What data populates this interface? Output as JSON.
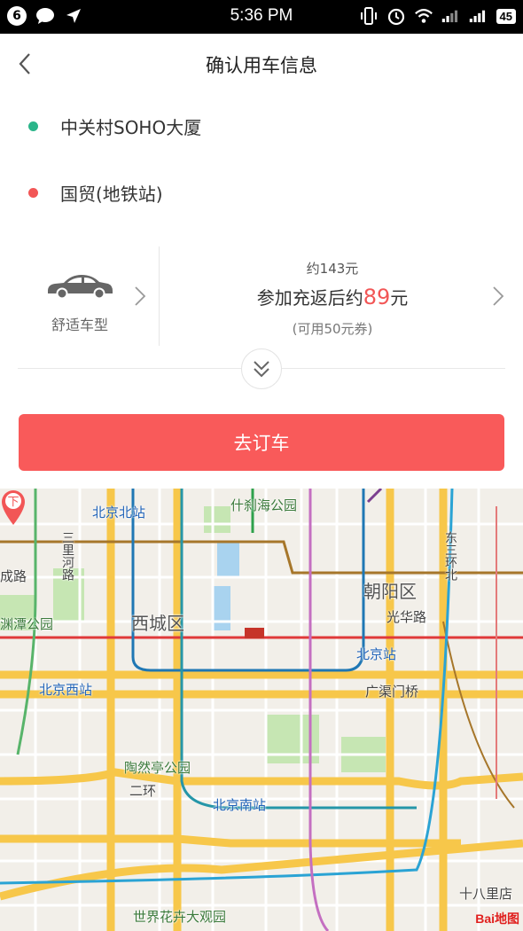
{
  "status_bar": {
    "notification_count": "6",
    "time": "5:36 PM",
    "battery": "45"
  },
  "header": {
    "title": "确认用车信息"
  },
  "route": {
    "start": "中关村SOHO大厦",
    "end": "国贸(地铁站)",
    "start_color": "#2bb58a",
    "end_color": "#f25656"
  },
  "car": {
    "type_label": "舒适车型"
  },
  "price": {
    "approx": "约143元",
    "main_prefix": "参加充返后约",
    "main_value": "89",
    "main_suffix": "元",
    "coupon": "(可用50元券)"
  },
  "order_button": {
    "label": "去订车",
    "color": "#f95a5a"
  },
  "map": {
    "labels": {
      "beijing_north": "北京北站",
      "shichahai": "什刹海公园",
      "sanlihe": "三里河路",
      "chengqu": "成路",
      "yuyuantan": "渊潭公园",
      "xicheng": "西城区",
      "chaoyang": "朝阳区",
      "guanghua": "光华路",
      "dongsanhuan": "东三环北",
      "beijing_station": "北京站",
      "beijing_west": "北京西站",
      "guangqumen": "广渠门桥",
      "taoranting": "陶然亭公园",
      "erhuan": "二环",
      "beijing_south": "北京南站",
      "shibali": "十八里店",
      "shijie_huahui": "世界花卉大观园"
    },
    "pin_label": "下",
    "logo": "Bai地图"
  }
}
